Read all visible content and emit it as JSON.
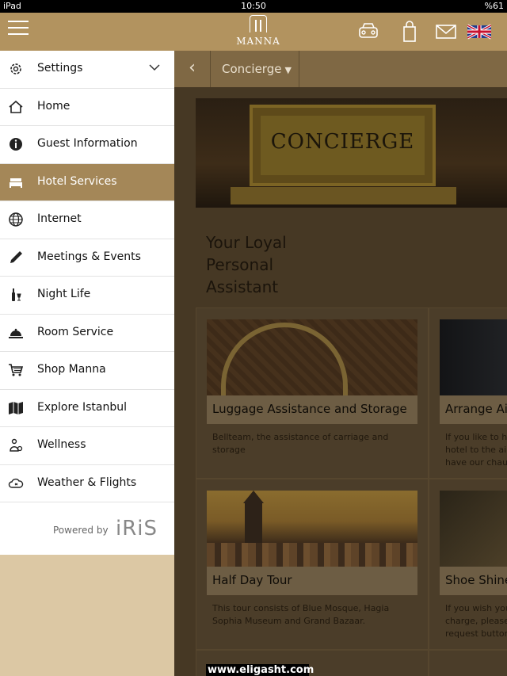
{
  "status_bar": {
    "device": "iPad",
    "time": "10:50",
    "battery": "%61"
  },
  "header": {
    "logo_text": "MANNA",
    "icons": [
      "car-icon",
      "shopping-bag-icon",
      "mail-icon",
      "uk-flag-icon"
    ]
  },
  "sidebar": {
    "items": [
      {
        "label": "Settings",
        "icon": "gear-icon"
      },
      {
        "label": "Home",
        "icon": "home-icon"
      },
      {
        "label": "Guest Information",
        "icon": "info-icon"
      },
      {
        "label": "Hotel Services",
        "icon": "bed-icon",
        "active": true
      },
      {
        "label": "Internet",
        "icon": "globe-icon"
      },
      {
        "label": "Meetings & Events",
        "icon": "pen-icon"
      },
      {
        "label": "Night Life",
        "icon": "bottle-icon"
      },
      {
        "label": "Room Service",
        "icon": "cloche-icon"
      },
      {
        "label": "Shop Manna",
        "icon": "cart-icon"
      },
      {
        "label": "Explore Istanbul",
        "icon": "map-icon"
      },
      {
        "label": "Wellness",
        "icon": "wellness-icon"
      },
      {
        "label": "Weather & Flights",
        "icon": "weather-icon"
      }
    ],
    "powered_by": "Powered by",
    "brand": "iRiS"
  },
  "main": {
    "section_select": "Concierge",
    "banner_text": "CONCIERGE",
    "headline": [
      "Your Loyal",
      "Personal",
      "Assistant"
    ],
    "cards": [
      {
        "title": "Luggage Assistance and Storage",
        "description": "Bellteam, the assistance of carriage and storage"
      },
      {
        "title": "Arrange Air",
        "description": "If you like to ha hotel to the air have our chauf"
      },
      {
        "title": "Half Day Tour",
        "description": "This tour consists of Blue Mosque, Hagia Sophia Museum and Grand Bazaar."
      },
      {
        "title": "Shoe Shine",
        "description": "If you wish you charge, please request button"
      }
    ]
  },
  "watermark": "www.eligasht.com",
  "colors": {
    "brand_gold": "#b2935f",
    "active_item": "#a48758"
  }
}
